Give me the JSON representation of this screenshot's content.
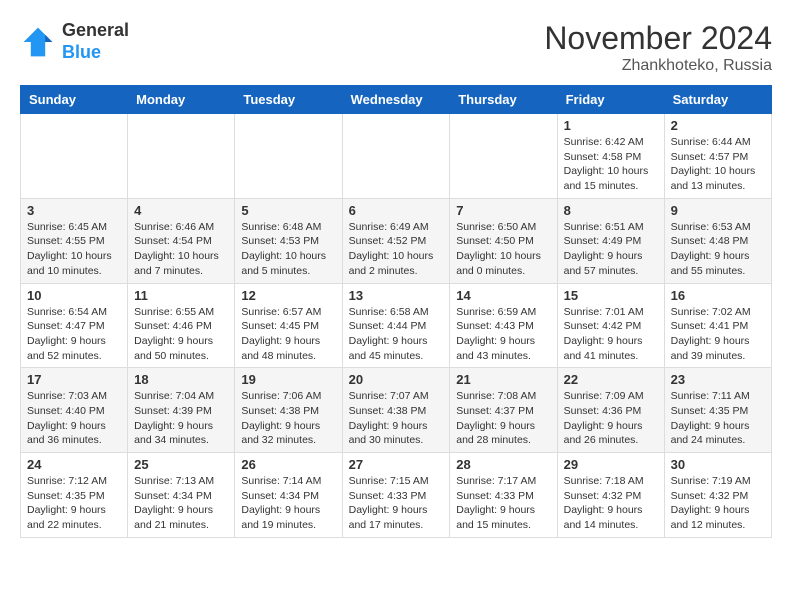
{
  "header": {
    "logo": {
      "general": "General",
      "blue": "Blue"
    },
    "title": "November 2024",
    "location": "Zhankhoteko, Russia"
  },
  "weekdays": [
    "Sunday",
    "Monday",
    "Tuesday",
    "Wednesday",
    "Thursday",
    "Friday",
    "Saturday"
  ],
  "weeks": [
    [
      {
        "day": "",
        "info": ""
      },
      {
        "day": "",
        "info": ""
      },
      {
        "day": "",
        "info": ""
      },
      {
        "day": "",
        "info": ""
      },
      {
        "day": "",
        "info": ""
      },
      {
        "day": "1",
        "info": "Sunrise: 6:42 AM\nSunset: 4:58 PM\nDaylight: 10 hours and 15 minutes."
      },
      {
        "day": "2",
        "info": "Sunrise: 6:44 AM\nSunset: 4:57 PM\nDaylight: 10 hours and 13 minutes."
      }
    ],
    [
      {
        "day": "3",
        "info": "Sunrise: 6:45 AM\nSunset: 4:55 PM\nDaylight: 10 hours and 10 minutes."
      },
      {
        "day": "4",
        "info": "Sunrise: 6:46 AM\nSunset: 4:54 PM\nDaylight: 10 hours and 7 minutes."
      },
      {
        "day": "5",
        "info": "Sunrise: 6:48 AM\nSunset: 4:53 PM\nDaylight: 10 hours and 5 minutes."
      },
      {
        "day": "6",
        "info": "Sunrise: 6:49 AM\nSunset: 4:52 PM\nDaylight: 10 hours and 2 minutes."
      },
      {
        "day": "7",
        "info": "Sunrise: 6:50 AM\nSunset: 4:50 PM\nDaylight: 10 hours and 0 minutes."
      },
      {
        "day": "8",
        "info": "Sunrise: 6:51 AM\nSunset: 4:49 PM\nDaylight: 9 hours and 57 minutes."
      },
      {
        "day": "9",
        "info": "Sunrise: 6:53 AM\nSunset: 4:48 PM\nDaylight: 9 hours and 55 minutes."
      }
    ],
    [
      {
        "day": "10",
        "info": "Sunrise: 6:54 AM\nSunset: 4:47 PM\nDaylight: 9 hours and 52 minutes."
      },
      {
        "day": "11",
        "info": "Sunrise: 6:55 AM\nSunset: 4:46 PM\nDaylight: 9 hours and 50 minutes."
      },
      {
        "day": "12",
        "info": "Sunrise: 6:57 AM\nSunset: 4:45 PM\nDaylight: 9 hours and 48 minutes."
      },
      {
        "day": "13",
        "info": "Sunrise: 6:58 AM\nSunset: 4:44 PM\nDaylight: 9 hours and 45 minutes."
      },
      {
        "day": "14",
        "info": "Sunrise: 6:59 AM\nSunset: 4:43 PM\nDaylight: 9 hours and 43 minutes."
      },
      {
        "day": "15",
        "info": "Sunrise: 7:01 AM\nSunset: 4:42 PM\nDaylight: 9 hours and 41 minutes."
      },
      {
        "day": "16",
        "info": "Sunrise: 7:02 AM\nSunset: 4:41 PM\nDaylight: 9 hours and 39 minutes."
      }
    ],
    [
      {
        "day": "17",
        "info": "Sunrise: 7:03 AM\nSunset: 4:40 PM\nDaylight: 9 hours and 36 minutes."
      },
      {
        "day": "18",
        "info": "Sunrise: 7:04 AM\nSunset: 4:39 PM\nDaylight: 9 hours and 34 minutes."
      },
      {
        "day": "19",
        "info": "Sunrise: 7:06 AM\nSunset: 4:38 PM\nDaylight: 9 hours and 32 minutes."
      },
      {
        "day": "20",
        "info": "Sunrise: 7:07 AM\nSunset: 4:38 PM\nDaylight: 9 hours and 30 minutes."
      },
      {
        "day": "21",
        "info": "Sunrise: 7:08 AM\nSunset: 4:37 PM\nDaylight: 9 hours and 28 minutes."
      },
      {
        "day": "22",
        "info": "Sunrise: 7:09 AM\nSunset: 4:36 PM\nDaylight: 9 hours and 26 minutes."
      },
      {
        "day": "23",
        "info": "Sunrise: 7:11 AM\nSunset: 4:35 PM\nDaylight: 9 hours and 24 minutes."
      }
    ],
    [
      {
        "day": "24",
        "info": "Sunrise: 7:12 AM\nSunset: 4:35 PM\nDaylight: 9 hours and 22 minutes."
      },
      {
        "day": "25",
        "info": "Sunrise: 7:13 AM\nSunset: 4:34 PM\nDaylight: 9 hours and 21 minutes."
      },
      {
        "day": "26",
        "info": "Sunrise: 7:14 AM\nSunset: 4:34 PM\nDaylight: 9 hours and 19 minutes."
      },
      {
        "day": "27",
        "info": "Sunrise: 7:15 AM\nSunset: 4:33 PM\nDaylight: 9 hours and 17 minutes."
      },
      {
        "day": "28",
        "info": "Sunrise: 7:17 AM\nSunset: 4:33 PM\nDaylight: 9 hours and 15 minutes."
      },
      {
        "day": "29",
        "info": "Sunrise: 7:18 AM\nSunset: 4:32 PM\nDaylight: 9 hours and 14 minutes."
      },
      {
        "day": "30",
        "info": "Sunrise: 7:19 AM\nSunset: 4:32 PM\nDaylight: 9 hours and 12 minutes."
      }
    ]
  ]
}
